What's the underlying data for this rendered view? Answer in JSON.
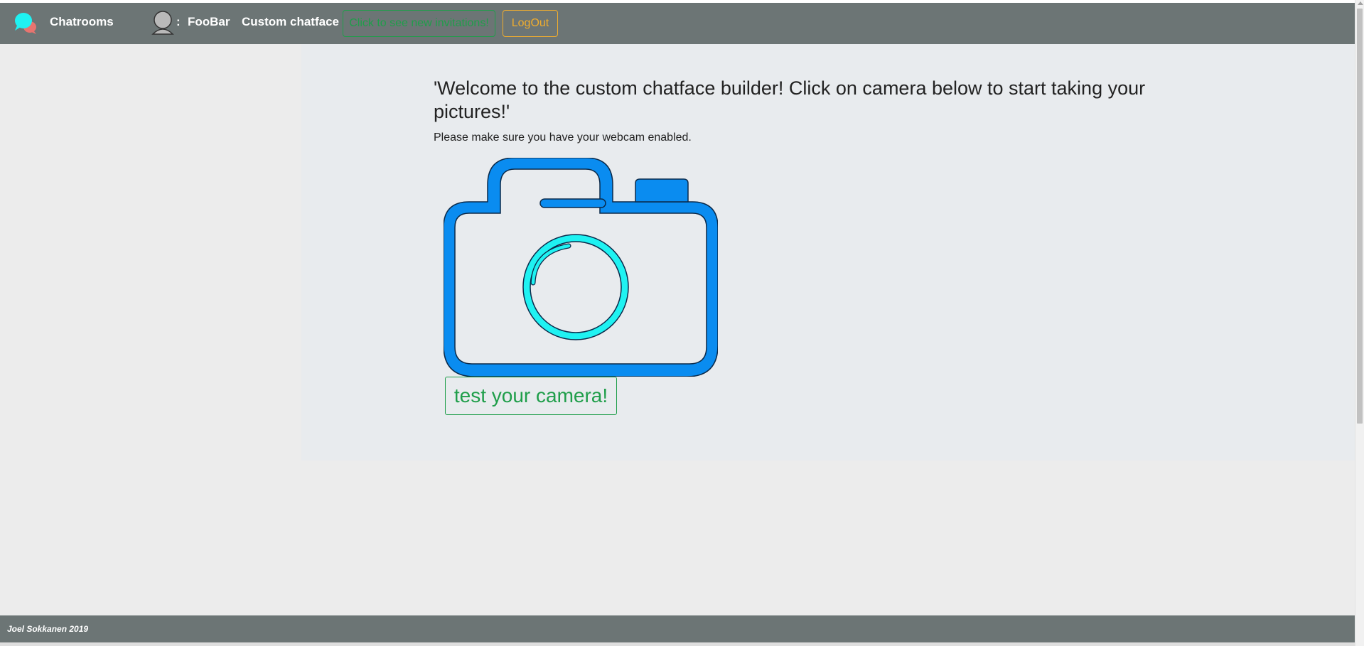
{
  "navbar": {
    "brand_label": "Chatrooms",
    "brand_icon": "chat-bubbles-icon",
    "user_icon": "user-avatar-icon",
    "colon": ":",
    "username": "FooBar",
    "custom_chatface_label": "Custom chatface",
    "invitations_button": "Click to see new invitations!",
    "logout_button": "LogOut"
  },
  "main": {
    "heading": "'Welcome to the custom chatface builder! Click on camera below to start taking your pictures!'",
    "subtext": "Please make sure you have your webcam enabled.",
    "camera_icon": "camera-icon",
    "test_camera_button": "test your camera!"
  },
  "footer": {
    "text": "Joel Sokkanen 2019"
  },
  "colors": {
    "navbar_bg": "#6c7575",
    "panel_bg": "#e8ebee",
    "camera_blue": "#0a8cf0",
    "lens_cyan": "#1ff2f2",
    "success_green": "#1f9e4a",
    "warning_orange": "#f0ad2e"
  }
}
